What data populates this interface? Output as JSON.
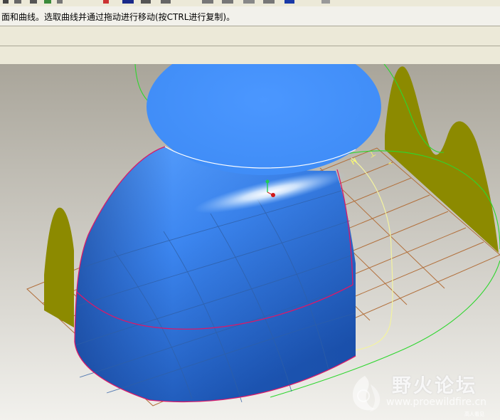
{
  "message_bar": {
    "text": "面和曲线。选取曲线并通过拖动进行移动(按CTRL进行复制)。"
  },
  "viewport": {
    "background_top": "#a9a59a",
    "background_bottom": "#f2f1ed",
    "surface_color": "#3d86ee",
    "cap_color": "#4693ff",
    "datum_plane_color": "#b2703c",
    "side_plane_color": "#8c8a00",
    "curve_color": "#2ed62e",
    "edge_color": "#d81a6a",
    "label_color": "#ffff66",
    "labels": {
      "dim_h": "H",
      "dim_arrow": "⌃",
      "dim_t": "⊥"
    }
  },
  "watermark": {
    "title": "野火论坛",
    "url": "www.proewildfire.cn",
    "small_text": "高人看见"
  }
}
